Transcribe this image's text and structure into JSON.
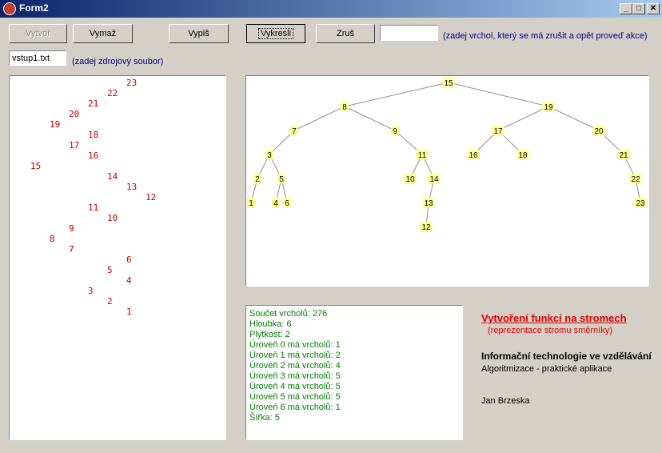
{
  "window": {
    "title": "Form2",
    "minimize": "_",
    "maximize": "□",
    "close": "✕"
  },
  "toolbar": {
    "create": "Vytvoř",
    "delete": "Vymaž",
    "print": "Vypiš",
    "draw": "Vykresli",
    "cancel": "Zruš",
    "vertex_value": "",
    "vertex_hint": "(zadej vrchol, který se má zrušit a opět proveď akce)"
  },
  "source": {
    "file_value": "vstup1.txt",
    "file_hint": "(zadej zdrojový soubor)"
  },
  "tree_print": [
    {
      "v": "23",
      "d": 6
    },
    {
      "v": "22",
      "d": 5
    },
    {
      "v": "21",
      "d": 4
    },
    {
      "v": "20",
      "d": 3
    },
    {
      "v": "19",
      "d": 2
    },
    {
      "v": "18",
      "d": 4
    },
    {
      "v": "17",
      "d": 3
    },
    {
      "v": "16",
      "d": 4
    },
    {
      "v": "15",
      "d": 1
    },
    {
      "v": "14",
      "d": 5
    },
    {
      "v": "13",
      "d": 6
    },
    {
      "v": "12",
      "d": 7
    },
    {
      "v": "11",
      "d": 4
    },
    {
      "v": "10",
      "d": 5
    },
    {
      "v": "9",
      "d": 3
    },
    {
      "v": "8",
      "d": 2
    },
    {
      "v": "7",
      "d": 3
    },
    {
      "v": "6",
      "d": 6
    },
    {
      "v": "5",
      "d": 5
    },
    {
      "v": "4",
      "d": 6
    },
    {
      "v": "3",
      "d": 4
    },
    {
      "v": "2",
      "d": 5
    },
    {
      "v": "1",
      "d": 6
    }
  ],
  "tree": {
    "colors": {
      "node": "#ffff99",
      "edge": "#909090"
    },
    "nodes": [
      "15",
      "8",
      "19",
      "7",
      "9",
      "17",
      "20",
      "3",
      "11",
      "16",
      "18",
      "21",
      "2",
      "5",
      "10",
      "14",
      "22",
      "1",
      "4",
      "6",
      "13",
      "23",
      "12"
    ],
    "edges": [
      [
        "15",
        "8"
      ],
      [
        "15",
        "19"
      ],
      [
        "8",
        "7"
      ],
      [
        "8",
        "9"
      ],
      [
        "19",
        "17"
      ],
      [
        "19",
        "20"
      ],
      [
        "7",
        "3"
      ],
      [
        "9",
        "11"
      ],
      [
        "17",
        "16"
      ],
      [
        "17",
        "18"
      ],
      [
        "20",
        "21"
      ],
      [
        "3",
        "2"
      ],
      [
        "3",
        "5"
      ],
      [
        "11",
        "10"
      ],
      [
        "11",
        "14"
      ],
      [
        "21",
        "22"
      ],
      [
        "2",
        "1"
      ],
      [
        "5",
        "4"
      ],
      [
        "5",
        "6"
      ],
      [
        "14",
        "13"
      ],
      [
        "22",
        "23"
      ],
      [
        "13",
        "12"
      ]
    ]
  },
  "stats": [
    "Součet vrcholů: 276",
    "Hloubka: 6",
    "Plytkost: 2",
    "Úroveň 0 má vrcholů: 1",
    "Úroveň 1 má vrcholů: 2",
    "Úroveň 2 má vrcholů: 4",
    "Úroveň 3 má vrcholů: 5",
    "Úroveň 4 má vrcholů: 5",
    "Úroveň 5 má vrcholů: 5",
    "Úroveň 6 má vrcholů: 1",
    "Šířka: 5"
  ],
  "info": {
    "title": "Vytvoření funkcí na stromech",
    "subtitle": "(reprezentace stromu směrníky)",
    "course": "Informační technologie ve vzdělávání",
    "topic": "Algoritmizace - praktické aplikace",
    "author": "Jan Brzeska"
  }
}
